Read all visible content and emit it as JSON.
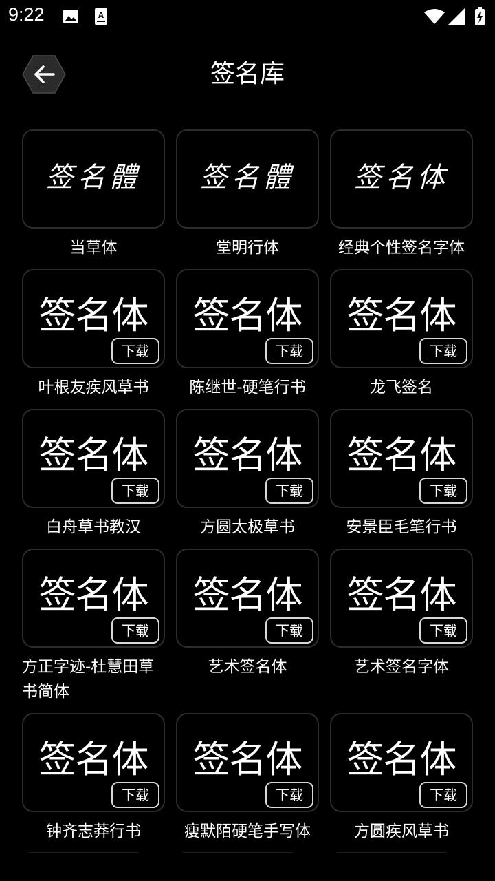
{
  "status_bar": {
    "time": "9:22",
    "icons": [
      "image-icon",
      "a-keyboard-icon",
      "wifi-icon",
      "signal-icon",
      "battery-charging-icon"
    ]
  },
  "header": {
    "back_icon": "arrow-left-icon",
    "title": "签名库"
  },
  "fonts": [
    {
      "name": "当草体",
      "preview": "签名體",
      "download": ""
    },
    {
      "name": "堂明行体",
      "preview": "签名體",
      "download": ""
    },
    {
      "name": "经典个性签名字体",
      "preview": "签名体",
      "download": ""
    },
    {
      "name": "叶根友疾风草书",
      "preview": "签名体",
      "download": "下载"
    },
    {
      "name": "陈继世-硬笔行书",
      "preview": "签名体",
      "download": "下载"
    },
    {
      "name": "龙飞签名",
      "preview": "签名体",
      "download": "下载"
    },
    {
      "name": "白舟草书教汉",
      "preview": "签名体",
      "download": "下载"
    },
    {
      "name": "方圆太极草书",
      "preview": "签名体",
      "download": "下载"
    },
    {
      "name": "安景臣毛笔行书",
      "preview": "签名体",
      "download": "下载"
    },
    {
      "name": "方正字迹-杜慧田草书简体",
      "preview": "签名体",
      "download": "下载"
    },
    {
      "name": "艺术签名体",
      "preview": "签名体",
      "download": "下载"
    },
    {
      "name": "艺术签名字体",
      "preview": "签名体",
      "download": "下载"
    },
    {
      "name": "钟齐志莽行书",
      "preview": "签名体",
      "download": "下载"
    },
    {
      "name": "瘦默陌硬笔手写体",
      "preview": "签名体",
      "download": "下载"
    },
    {
      "name": "方圆疾风草书",
      "preview": "签名体",
      "download": "下载"
    }
  ]
}
